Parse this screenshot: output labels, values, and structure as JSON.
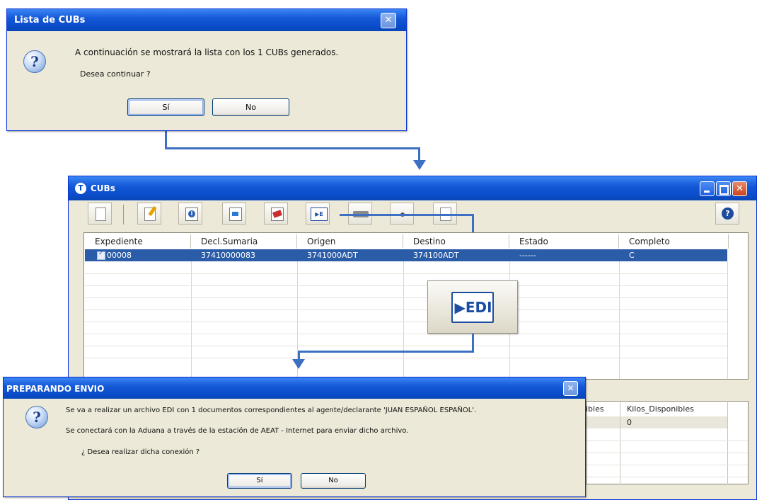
{
  "dialog1": {
    "title": "Lista de CUBs",
    "message": "A continuación se mostrará la lista con los 1 CUBs generados.",
    "question": "Desea continuar ?",
    "yes_label": "Sí",
    "no_label": "No"
  },
  "main": {
    "title": "CUBs",
    "help_label": "?",
    "toolbar_icons": [
      "new-icon",
      "edit-icon",
      "info-icon",
      "import-icon",
      "delete-icon",
      "edi-icon",
      "print-icon",
      "connect-icon",
      "export-icon"
    ],
    "columns": [
      "Expediente",
      "Decl.Sumaria",
      "Origen",
      "Destino",
      "Estado",
      "Completo"
    ],
    "row": [
      "00008",
      "37410000083",
      "3741000ADT",
      "374100ADT",
      "------",
      "C"
    ],
    "edi_label": "▶EDI",
    "lower_columns": [
      "ibles",
      "Kilos_Disponibles"
    ],
    "lower_row": [
      "",
      "0"
    ]
  },
  "dialog2": {
    "title": "PREPARANDO ENVIO",
    "line1": "Se va a realizar un archivo EDI con 1 documentos correspondientes al agente/declarante 'JUAN ESPAÑOL ESPAÑOL'.",
    "line2": "Se conectará con la Aduana a través de la estación de AEAT - Internet para enviar dicho archivo.",
    "line3": "¿ Desea realizar dicha conexión ?",
    "yes_label": "Sí",
    "no_label": "No"
  },
  "colors": {
    "titlebar": "#0a4bc8",
    "selection": "#2b5ca8",
    "arrow": "#3d6fc2",
    "window_bg": "#ece9d8"
  }
}
